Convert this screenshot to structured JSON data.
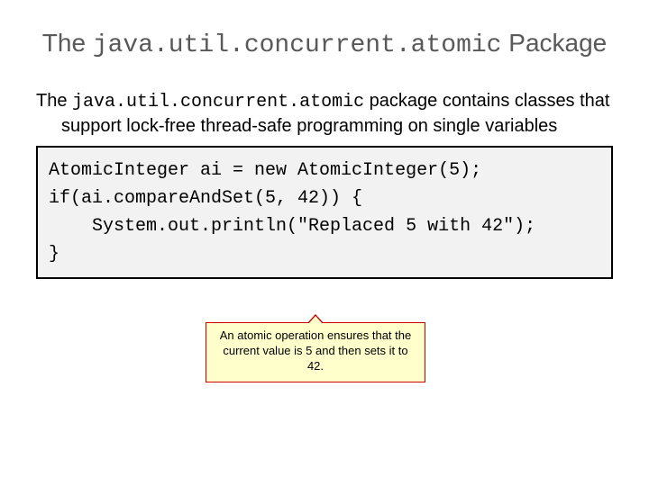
{
  "title": {
    "pre": "The ",
    "mono": "java.util.concurrent.atomic",
    "post": " Package"
  },
  "body": {
    "pre": "The ",
    "mono": "java.util.concurrent.atomic",
    "post": " package contains classes that support lock-free thread-safe programming on single variables"
  },
  "code": "AtomicInteger ai = new AtomicInteger(5);\nif(ai.compareAndSet(5, 42)) {\n    System.out.println(\"Replaced 5 with 42\");\n}",
  "callout": "An atomic operation ensures that the current value is 5 and then sets it to 42."
}
